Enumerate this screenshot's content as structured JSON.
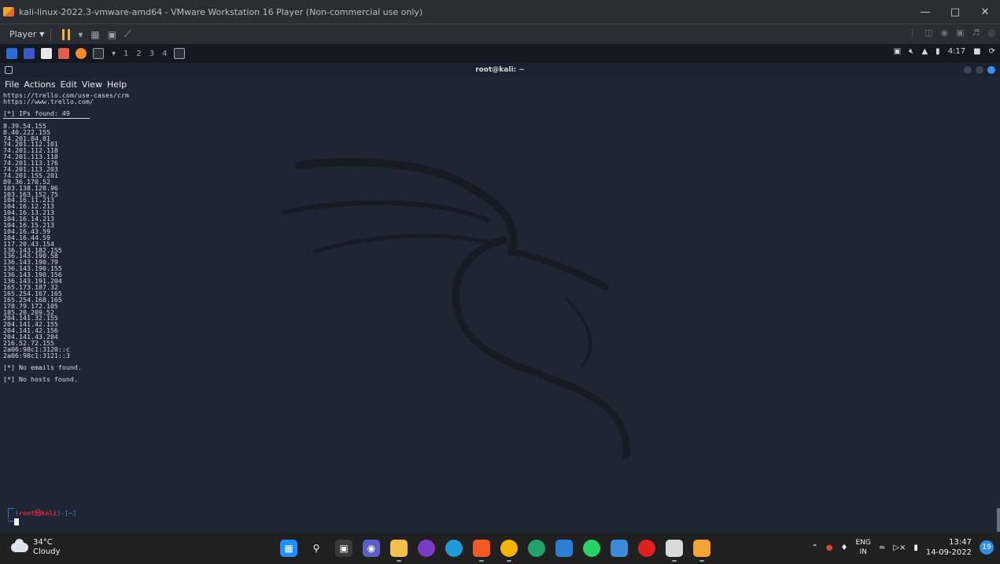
{
  "vmware": {
    "window_title": "kali-linux-2022.3-vmware-amd64 - VMware Workstation 16 Player (Non-commercial use only)",
    "player_label": "Player"
  },
  "kali_panel": {
    "workspaces": [
      "1",
      "2",
      "3",
      "4"
    ],
    "clock": "4:17"
  },
  "terminal": {
    "title": "root@kali: ~",
    "menu": [
      "File",
      "Actions",
      "Edit",
      "View",
      "Help"
    ],
    "urls": [
      "https://trello.com/use-cases/crm",
      "https://www.trello.com/"
    ],
    "ips_header": "[*] IPs found: 49",
    "ips": [
      "8.39.54.155",
      "8.40.222.155",
      "74.201.84.81",
      "74.201.112.101",
      "74.201.112.118",
      "74.201.113.118",
      "74.201.113.176",
      "74.201.113.203",
      "74.201.155.201",
      "89.36.170.52",
      "103.138.128.96",
      "103.163.152.75",
      "104.16.11.213",
      "104.16.12.213",
      "104.16.13.213",
      "104.16.14.213",
      "104.16.15.213",
      "104.16.43.59",
      "104.16.44.59",
      "117.20.43.154",
      "136.143.182.155",
      "136.143.190.58",
      "136.143.190.79",
      "136.143.190.155",
      "136.143.190.156",
      "136.143.191.204",
      "165.173.187.32",
      "165.254.167.165",
      "165.254.168.165",
      "178.79.172.105",
      "185.20.209.52",
      "204.141.32.155",
      "204.141.42.155",
      "204.141.42.156",
      "204.141.43.204",
      "216.52.72.155",
      "2a06:98c1:3120::c",
      "2a06:98c1:3121::3"
    ],
    "no_emails": "[*] No emails found.",
    "no_hosts": "[*] No hosts found.",
    "prompt_user": "root㉿kali",
    "prompt_path": "~"
  },
  "taskbar": {
    "temperature": "34°C",
    "condition": "Cloudy",
    "lang_top": "ENG",
    "lang_bottom": "IN",
    "time": "13:47",
    "date": "14-09-2022",
    "notifications": "19"
  }
}
